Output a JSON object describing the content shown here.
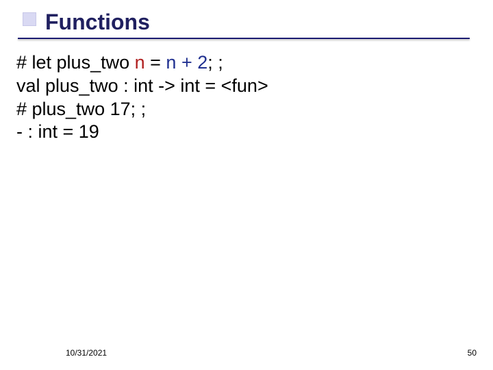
{
  "title": "Functions",
  "code": {
    "line1_prefix": "# let plus_two ",
    "line1_red": "n",
    "line1_mid": " = ",
    "line1_blue": "n + 2",
    "line1_suffix": "; ;",
    "line2": "val plus_two : int -> int = <fun>",
    "line3": "# plus_two 17; ;",
    "line4": "- : int = 19"
  },
  "footer": {
    "date": "10/31/2021",
    "page": "50"
  }
}
